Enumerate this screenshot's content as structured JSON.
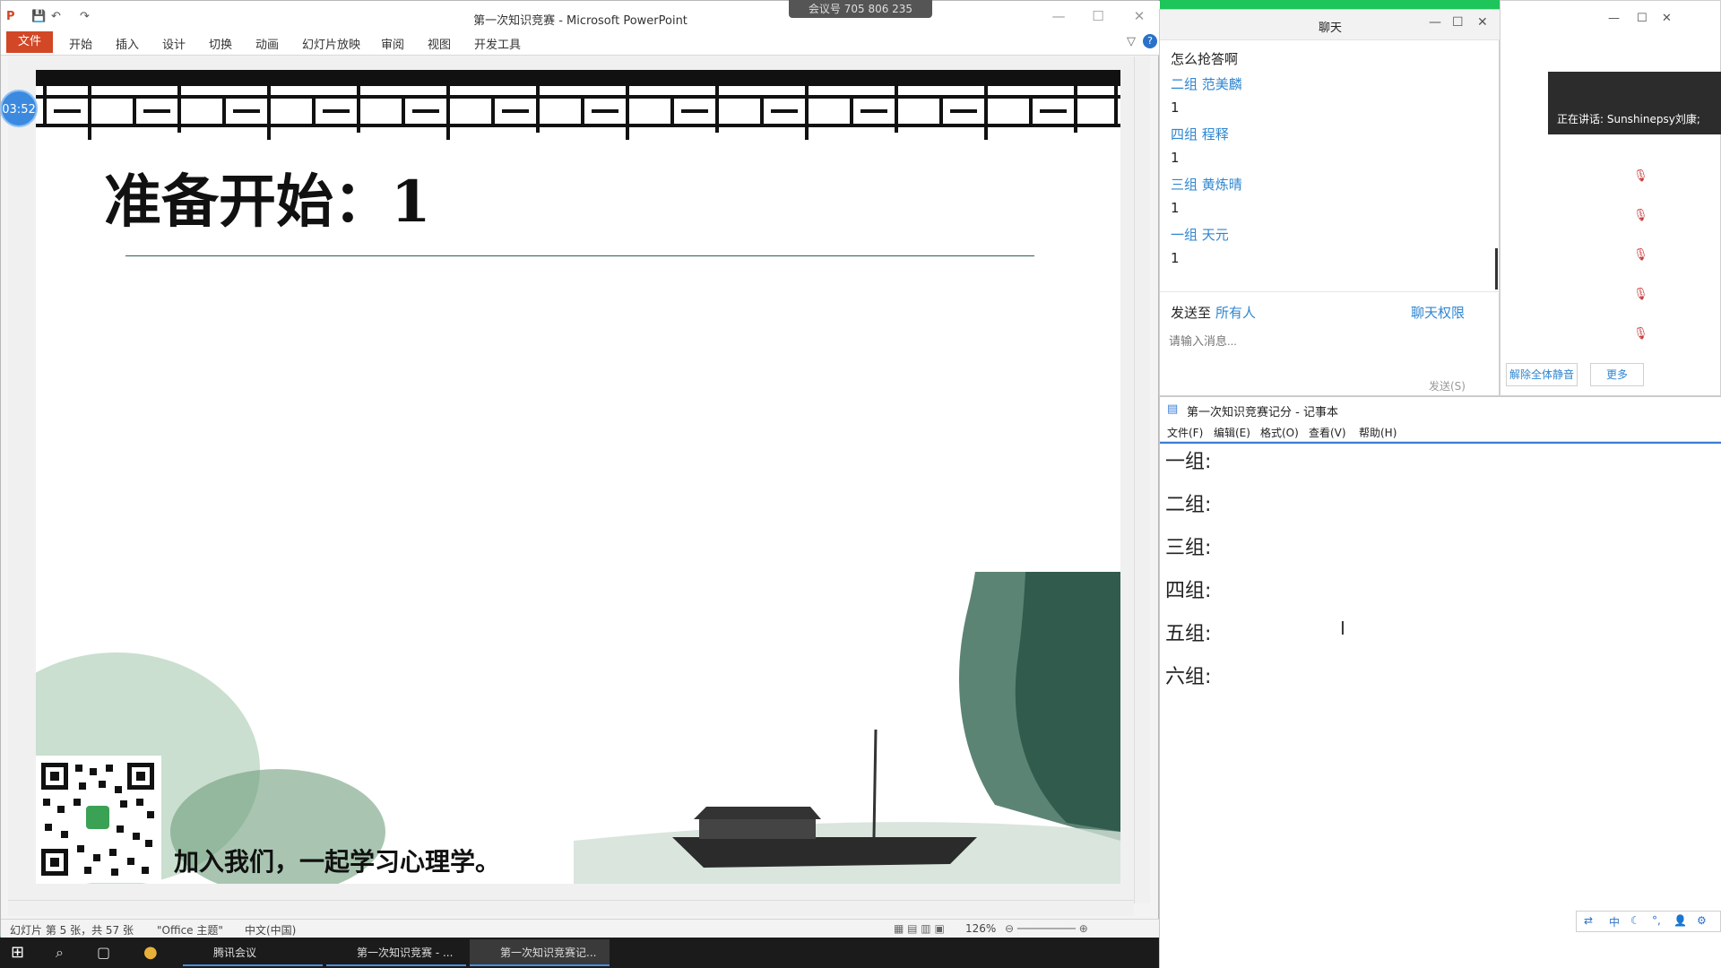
{
  "meeting_pill": "会议号 705 806 235",
  "timer": "03:52",
  "ppt": {
    "title": "第一次知识竞赛 - Microsoft PowerPoint",
    "tabs": [
      "文件",
      "开始",
      "插入",
      "设计",
      "切换",
      "动画",
      "幻灯片放映",
      "审阅",
      "视图",
      "开发工具"
    ],
    "slide_title": "准备开始：1",
    "caption": "加入我们，一起学习心理学。",
    "status_slide": "幻灯片 第 5 张，共 57 张",
    "status_theme": "\"Office 主题\"",
    "status_lang": "中文(中国)",
    "zoom": "126%",
    "accent": "#d24726"
  },
  "taskbar": {
    "items": [
      "腾讯会议",
      "第一次知识竞赛 - ...",
      "第一次知识竞赛记..."
    ]
  },
  "chat": {
    "title": "聊天",
    "messages": [
      {
        "type": "text",
        "text": "怎么抢答啊"
      },
      {
        "type": "name",
        "text": "二组 范美麟"
      },
      {
        "type": "text",
        "text": "1"
      },
      {
        "type": "name",
        "text": "四组 程释"
      },
      {
        "type": "text",
        "text": "1"
      },
      {
        "type": "name",
        "text": "三组 黄炼晴"
      },
      {
        "type": "text",
        "text": "1"
      },
      {
        "type": "name",
        "text": "一组 天元"
      },
      {
        "type": "text",
        "text": "1"
      }
    ],
    "send_to_label": "发送至",
    "send_to_value": "所有人",
    "permission": "聊天权限",
    "placeholder": "请输入消息...",
    "send_button": "发送(S)"
  },
  "panel": {
    "speaking": "正在讲话: Sunshinepsy刘康;",
    "unmute_all": "解除全体静音",
    "more": "更多"
  },
  "notepad": {
    "title": "第一次知识竞赛记分 - 记事本",
    "menu": [
      "文件(F)",
      "编辑(E)",
      "格式(O)",
      "查看(V)",
      "帮助(H)"
    ],
    "lines": [
      "一组:",
      "二组:",
      "三组:",
      "四组:",
      "五组:",
      "六组:"
    ]
  },
  "ime": {
    "mode": "中"
  }
}
